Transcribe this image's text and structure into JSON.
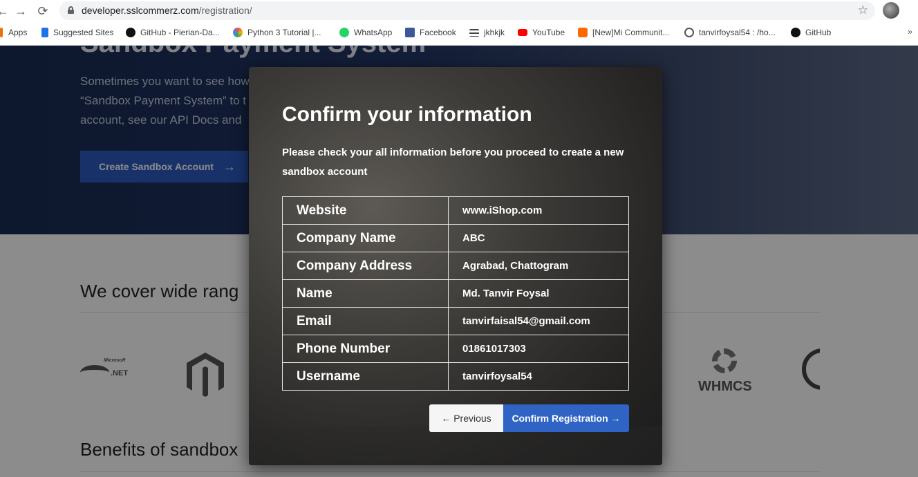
{
  "browser": {
    "url_domain": "developer.sslcommerz.com",
    "url_path": "/registration/",
    "back": "←",
    "forward": "→",
    "reload": "⟳",
    "star": "☆"
  },
  "bookmarks": {
    "items": [
      {
        "label": "Apps",
        "color": "#e8710a"
      },
      {
        "label": "Suggested Sites",
        "color": "#1a73e8"
      },
      {
        "label": "GitHub - Pierian-Da...",
        "color": "#111111"
      },
      {
        "label": "Python 3 Tutorial |...",
        "color": "#e04f5f"
      },
      {
        "label": "WhatsApp",
        "color": "#25d366"
      },
      {
        "label": "Facebook",
        "color": "#3b5998"
      },
      {
        "label": "jkhkjk",
        "color": "#444444"
      },
      {
        "label": "YouTube",
        "color": "#ff0000"
      },
      {
        "label": "[New]Mi Communit...",
        "color": "#ff6900"
      },
      {
        "label": "tanvirfoysal54 : /ho...",
        "color": "#555555"
      },
      {
        "label": "GitHub",
        "color": "#111111"
      }
    ],
    "more": "»"
  },
  "hero": {
    "title": "Sandbox Payment System",
    "text_lines": [
      "Sometimes you want to see how",
      "“Sandbox Payment System” to t",
      "account, see our API Docs and"
    ],
    "create_button": "Create Sandbox Account",
    "create_arrow": "→"
  },
  "sections": {
    "cover_title": "We cover wide rang",
    "benefits_title": "Benefits of sandbox"
  },
  "logos": {
    "dotnet_small": "Microsoft",
    "dotnet": ".NET",
    "whmcs": "WHMCS"
  },
  "modal": {
    "title": "Confirm your information",
    "subtitle": "Please check your all information before you proceed to create a new sandbox account",
    "rows": [
      {
        "key": "Website",
        "value": "www.iShop.com"
      },
      {
        "key": "Company Name",
        "value": "ABC"
      },
      {
        "key": "Company Address",
        "value": "Agrabad, Chattogram"
      },
      {
        "key": "Name",
        "value": "Md. Tanvir Foysal"
      },
      {
        "key": "Email",
        "value": "tanvirfaisal54@gmail.com"
      },
      {
        "key": "Phone Number",
        "value": "01861017303"
      },
      {
        "key": "Username",
        "value": "tanvirfoysal54"
      }
    ],
    "previous_button": "← Previous",
    "confirm_button": "Confirm Registration →"
  }
}
